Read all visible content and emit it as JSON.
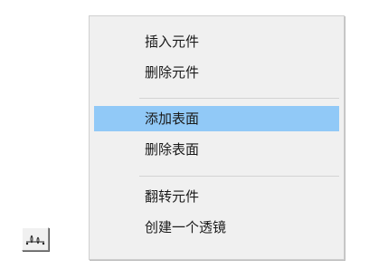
{
  "toolbar": {
    "icon": "lens-element-icon"
  },
  "menu": {
    "items": [
      {
        "label": "插入元件"
      },
      {
        "label": "删除元件"
      },
      {
        "label": "添加表面"
      },
      {
        "label": "删除表面"
      },
      {
        "label": "翻转元件"
      },
      {
        "label": "创建一个透镜"
      }
    ],
    "highlighted_item": "添加表面",
    "highlight_color": "#91c9f7"
  }
}
